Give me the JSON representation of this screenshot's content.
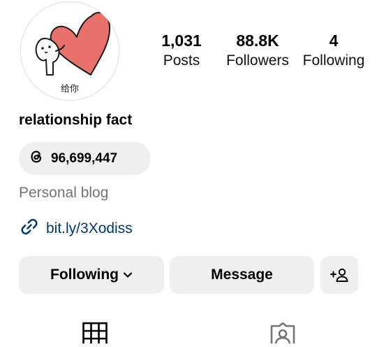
{
  "profile": {
    "avatar_caption": "给你",
    "username": "relationship fact",
    "category": "Personal blog",
    "link": "bit.ly/3Xodiss"
  },
  "stats": {
    "posts": {
      "value": "1,031",
      "label": "Posts"
    },
    "followers": {
      "value": "88.8K",
      "label": "Followers"
    },
    "following": {
      "value": "4",
      "label": "Following"
    }
  },
  "threads": {
    "count": "96,699,447",
    "icon": "threads-icon"
  },
  "actions": {
    "following_label": "Following",
    "message_label": "Message",
    "add_user_icon": "add-user-icon"
  },
  "tabs": [
    {
      "icon": "grid-icon"
    },
    {
      "icon": "tagged-icon"
    }
  ],
  "colors": {
    "button_bg": "#efefef",
    "link": "#00376b",
    "muted_text": "#737373",
    "heart": "#e8716b"
  }
}
